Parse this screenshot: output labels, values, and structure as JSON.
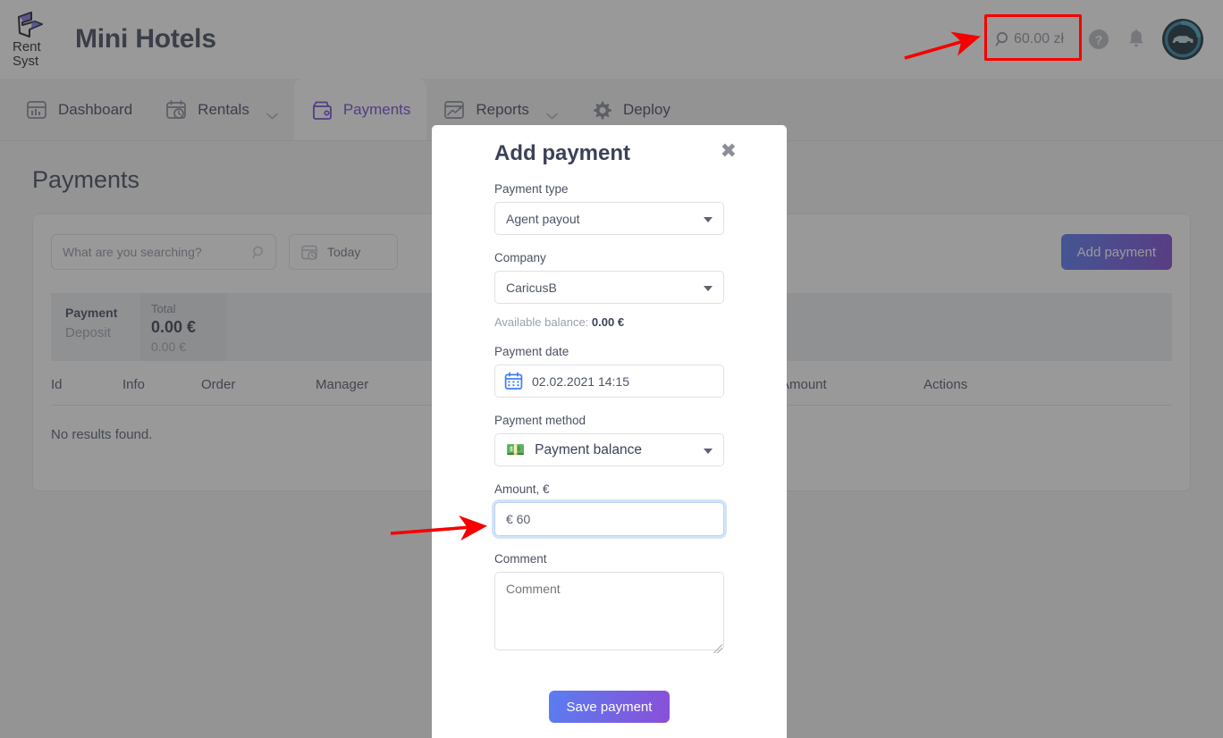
{
  "header": {
    "logo_line1": "Rent",
    "logo_line2": "Syst",
    "brand": "Mini Hotels",
    "balance": "60.00 zł",
    "icons": {
      "balance": "magnifier-icon",
      "help": "help-circle-icon",
      "bell": "bell-icon",
      "avatar": "car-avatar-icon"
    }
  },
  "nav": [
    {
      "label": "Dashboard",
      "icon": "dashboard-icon",
      "active": false,
      "chevron": false
    },
    {
      "label": "Rentals",
      "icon": "calendar-clock-icon",
      "active": false,
      "chevron": true
    },
    {
      "label": "Payments",
      "icon": "wallet-icon",
      "active": true,
      "chevron": false
    },
    {
      "label": "Reports",
      "icon": "report-chart-icon",
      "active": false,
      "chevron": true
    },
    {
      "label": "Deploy",
      "icon": "gear-icon",
      "active": false,
      "chevron": false
    }
  ],
  "page": {
    "title": "Payments",
    "search_placeholder": "What are you searching?",
    "date_filter": "Today",
    "add_payment_label": "Add payment",
    "summary": {
      "row_labels": [
        "Payment",
        "Deposit"
      ],
      "column_header": "Total",
      "values": [
        "0.00 €",
        "0.00 €"
      ]
    },
    "table": {
      "columns": [
        "Id",
        "Info",
        "Order",
        "Manager",
        "Amount",
        "Actions"
      ],
      "empty_message": "No results found."
    }
  },
  "modal": {
    "title": "Add payment",
    "close_label": "✖",
    "payment_type": {
      "label": "Payment type",
      "value": "Agent payout"
    },
    "company": {
      "label": "Company",
      "value": "CaricusB"
    },
    "available_balance": {
      "prefix": "Available balance:",
      "value": "0.00 €"
    },
    "payment_date": {
      "label": "Payment date",
      "value": "02.02.2021 14:15",
      "icon": "calendar-icon"
    },
    "payment_method": {
      "label": "Payment method",
      "value": "Payment balance",
      "icon": "banknote-icon",
      "glyph": "💵"
    },
    "amount": {
      "label": "Amount, €",
      "value": "€ 60"
    },
    "comment": {
      "label": "Comment",
      "placeholder": "Comment",
      "value": ""
    },
    "save_label": "Save payment"
  },
  "annotations": {
    "highlight_target": "balance-chip",
    "arrow1_target": "balance-chip",
    "arrow2_target": "amount-input",
    "color": "#f60000"
  },
  "colors": {
    "accent_purple": "#6b3fd4",
    "button_gradient_start": "#5a7df0",
    "button_gradient_end": "#8a4fd8",
    "annotation_red": "#f60000",
    "focus_blue": "#b9d3f2"
  }
}
